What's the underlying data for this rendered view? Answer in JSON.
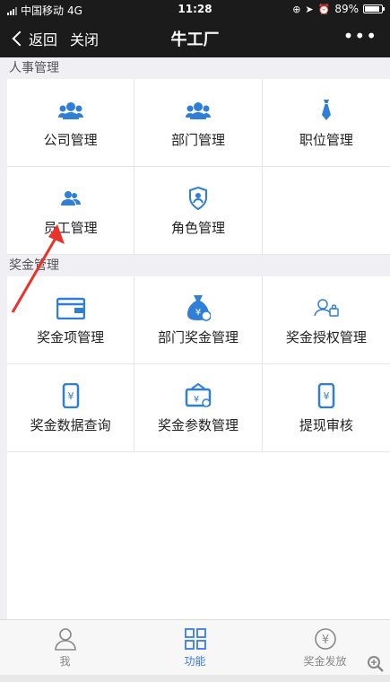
{
  "status": {
    "carrier": "中国移动",
    "network": "4G",
    "time": "11:28",
    "battery": "89%"
  },
  "nav": {
    "back_label": "返回",
    "close_label": "关闭",
    "title": "牛工厂",
    "more_label": "•••"
  },
  "sections": [
    {
      "title": "人事管理",
      "items": [
        {
          "label": "公司管理",
          "icon": "group-icon"
        },
        {
          "label": "部门管理",
          "icon": "group-icon"
        },
        {
          "label": "职位管理",
          "icon": "tie-icon"
        },
        {
          "label": "员工管理",
          "icon": "people-icon"
        },
        {
          "label": "角色管理",
          "icon": "shield-user-icon"
        }
      ]
    },
    {
      "title": "奖金管理",
      "items": [
        {
          "label": "奖金项管理",
          "icon": "wallet-icon"
        },
        {
          "label": "部门奖金管理",
          "icon": "money-bag-icon"
        },
        {
          "label": "奖金授权管理",
          "icon": "user-key-icon"
        },
        {
          "label": "奖金数据查询",
          "icon": "phone-yen-icon"
        },
        {
          "label": "奖金参数管理",
          "icon": "briefcase-yen-icon"
        },
        {
          "label": "提现审核",
          "icon": "phone-yen-icon"
        }
      ]
    }
  ],
  "tabs": [
    {
      "label": "我",
      "icon": "person-icon",
      "active": false
    },
    {
      "label": "功能",
      "icon": "grid-icon",
      "active": true
    },
    {
      "label": "奖金发放",
      "icon": "yen-circle-icon",
      "active": false
    }
  ],
  "colors": {
    "bar_bg": "#1b1b1b",
    "accent": "#3c7be8",
    "icon_blue": "#2f7fd6",
    "arrow": "#e8322a"
  }
}
